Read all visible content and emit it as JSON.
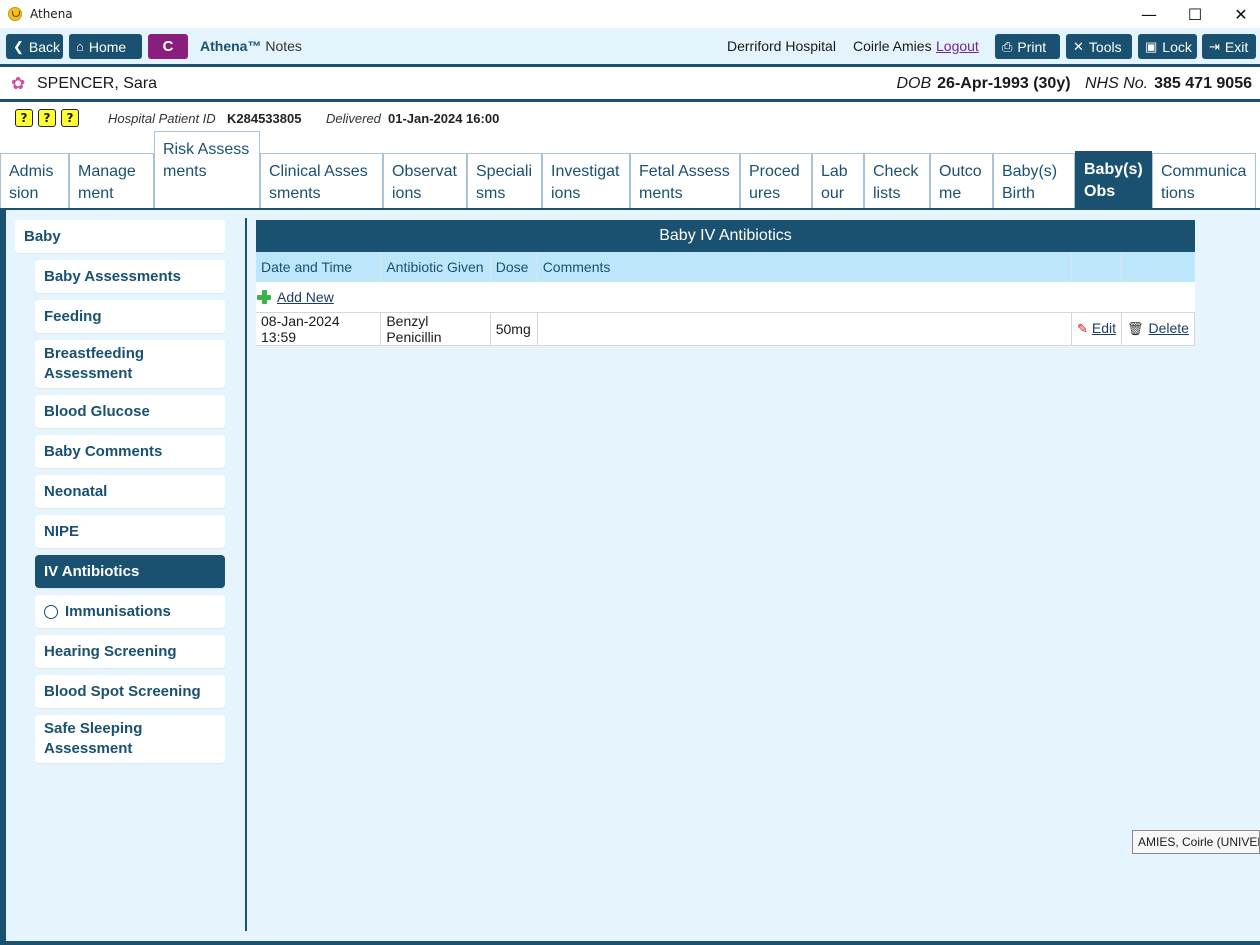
{
  "window": {
    "title": "Athena",
    "minimize_icon": "—",
    "maximize_icon": "☐",
    "close_icon": "✕"
  },
  "toolbar": {
    "back_label": "Back",
    "home_label": "Home",
    "context_label": "C",
    "product_name": "Athena™",
    "product_suffix": "Notes",
    "hospital": "Derriford Hospital",
    "user": "Coirle Amies",
    "logout_label": "Logout",
    "print_label": "Print",
    "tools_label": "Tools",
    "lock_label": "Lock",
    "exit_label": "Exit"
  },
  "patient": {
    "name": "SPENCER, Sara",
    "dob_label": "DOB",
    "dob_value": "26-Apr-1993 (30y)",
    "nhs_label": "NHS No.",
    "nhs_value": "385 471 9056",
    "hospital_id_label": "Hospital Patient ID",
    "hospital_id_value": "K284533805",
    "delivered_label": "Delivered",
    "delivered_value": "01-Jan-2024 16:00",
    "alerts": [
      "?",
      "?",
      "?"
    ]
  },
  "tabs": [
    {
      "label": "Admission"
    },
    {
      "label": "Management"
    },
    {
      "label": "Risk Assessments"
    },
    {
      "label": "Clinical Assessments"
    },
    {
      "label": "Observations"
    },
    {
      "label": "Specialisms"
    },
    {
      "label": "Investigations"
    },
    {
      "label": "Fetal Assessments"
    },
    {
      "label": "Procedures"
    },
    {
      "label": "Labour"
    },
    {
      "label": "Checklists"
    },
    {
      "label": "Outcome"
    },
    {
      "label": "Baby(s) Birth"
    },
    {
      "label": "Baby(s) Obs"
    },
    {
      "label": "Communications"
    }
  ],
  "active_tab": "Baby(s) Obs",
  "sidebar": {
    "items": [
      {
        "label": "Baby"
      },
      {
        "label": "Baby Assessments"
      },
      {
        "label": "Feeding"
      },
      {
        "label": "Breastfeeding Assessment"
      },
      {
        "label": "Blood Glucose"
      },
      {
        "label": "Baby Comments"
      },
      {
        "label": "Neonatal"
      },
      {
        "label": "NIPE"
      },
      {
        "label": "IV Antibiotics"
      },
      {
        "label": "Immunisations"
      },
      {
        "label": "Hearing Screening"
      },
      {
        "label": "Blood Spot Screening"
      },
      {
        "label": "Safe Sleeping Assessment"
      }
    ],
    "active": "IV Antibiotics"
  },
  "panel": {
    "title": "Baby IV Antibiotics",
    "columns": [
      "Date and Time",
      "Antibiotic Given",
      "Dose",
      "Comments",
      "",
      ""
    ],
    "add_new_label": "Add New",
    "rows": [
      {
        "date_time": "08-Jan-2024 13:59",
        "antibiotic": "Benzyl Penicillin",
        "dose": "50mg",
        "comments": "",
        "edit_label": "Edit",
        "delete_label": "Delete"
      }
    ]
  },
  "tooltip": "AMIES, Coirle (UNIVERS",
  "colors": {
    "primary": "#1a5170",
    "toolbar_bg": "#e4f4fc",
    "content_bg": "#e6f5fd",
    "header_row": "#bce6fa",
    "context_button": "#8a1e7e",
    "logout_link": "#7a1fa2",
    "alert_yellow": "#ffff33"
  }
}
